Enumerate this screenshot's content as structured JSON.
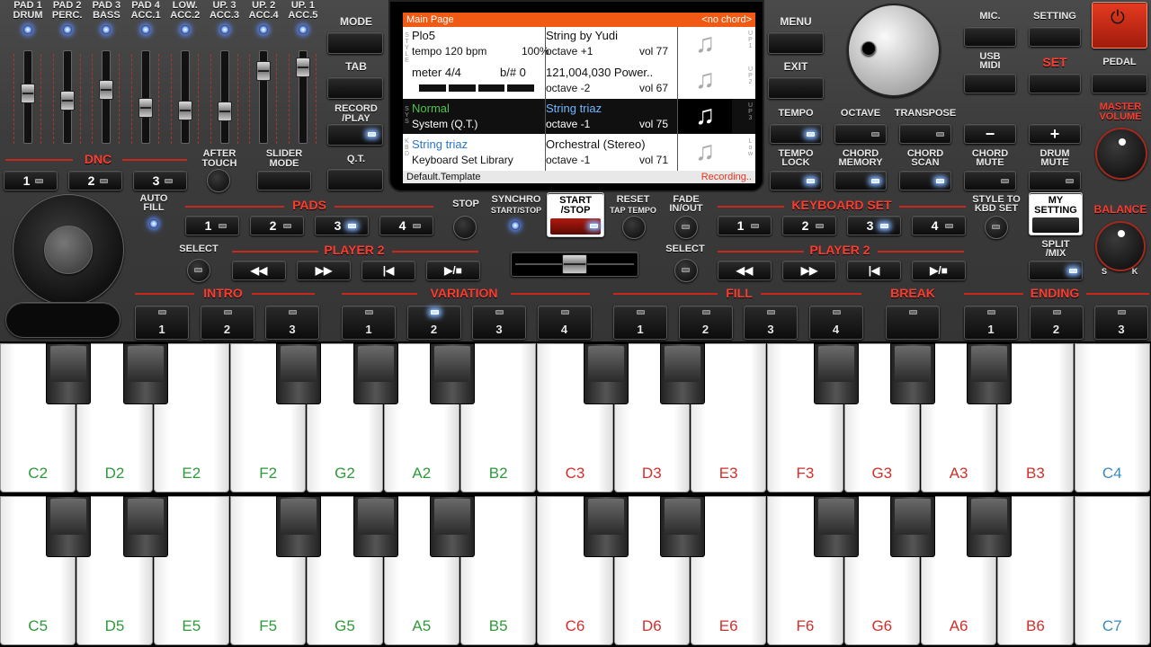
{
  "colors": {
    "accent_red": "#ff3b2e",
    "led_blue": "#7fb2ff",
    "lcd_header": "#f05a14"
  },
  "sliders": [
    {
      "label": "PAD 1\nDRUM",
      "level": 0.55
    },
    {
      "label": "PAD 2\nPERC.",
      "level": 0.45
    },
    {
      "label": "PAD 3\nBASS",
      "level": 0.6
    },
    {
      "label": "PAD 4\nACC.1",
      "level": 0.35
    },
    {
      "label": "LOW.\nACC.2",
      "level": 0.32
    },
    {
      "label": "UP. 3\nACC.3",
      "level": 0.3
    },
    {
      "label": "UP. 2\nACC.4",
      "level": 0.85
    },
    {
      "label": "UP. 1\nACC.5",
      "level": 0.9
    }
  ],
  "left_buttons": {
    "mode": "MODE",
    "tab": "TAB",
    "record": "RECORD\n/PLAY",
    "qt": "Q.T."
  },
  "dnc": {
    "label": "DNC",
    "b1": "1",
    "b2": "2",
    "b3": "3",
    "after_touch": "AFTER\nTOUCH",
    "slider_mode": "SLIDER\nMODE"
  },
  "lcd": {
    "title": "Main Page",
    "chord": "<no chord>",
    "style_name": "Plo5",
    "tempo": "tempo 120 bpm",
    "tempo_pct": "100%",
    "meter": "meter 4/4",
    "bsharp": "b/#  0",
    "up1_name": "String by Yudi",
    "up1_oct": "octave +1",
    "up1_vol": "vol 77",
    "up2_name": "121,004,030 Power..",
    "up2_oct": "octave -2",
    "up2_vol": "vol 67",
    "sys_name": "Normal",
    "sys_sub": "System (Q.T.)",
    "up3_name": "String triaz",
    "up3_oct": "octave -1",
    "up3_vol": "vol 75",
    "kbd_name": "String triaz",
    "kbd_sub": "Keyboard Set Library",
    "low_name": "Orchestral (Stereo)",
    "low_oct": "octave -1",
    "low_vol": "vol 71",
    "footer_left": "Default.Template",
    "footer_right": "Recording..",
    "side_style": "S T Y L E",
    "side_sys": "S Y S",
    "side_kbd": "K B D",
    "side_up1": "U P 1",
    "side_up2": "U P 2",
    "side_up3": "U P 3",
    "side_low": "L o w"
  },
  "right_top": {
    "menu": "MENU",
    "exit": "EXIT",
    "mic": "MIC.",
    "setting": "SETTING",
    "usb_midi": "USB\nMIDI",
    "set": "SET",
    "pedal": "PEDAL",
    "master_volume": "MASTER\nVOLUME",
    "balance": "BALANCE",
    "bal_s": "S",
    "bal_k": "K"
  },
  "function_row": {
    "tempo": "TEMPO",
    "octave": "OCTAVE",
    "transpose": "TRANSPOSE",
    "minus": "−",
    "plus": "+",
    "tempo_lock": "TEMPO\nLOCK",
    "chord_memory": "CHORD\nMEMORY",
    "chord_scan": "CHORD\nSCAN",
    "chord_mute": "CHORD\nMUTE",
    "drum_mute": "DRUM\nMUTE"
  },
  "mid_row": {
    "auto_fill": "AUTO\nFILL",
    "pads": "PADS",
    "stop": "STOP",
    "synchro": "SYNCHRO",
    "synchro_sub": "START/STOP",
    "start_stop": "START\n/STOP",
    "reset": "RESET",
    "tap_tempo": "TAP TEMPO",
    "fade": "FADE\nIN/OUT",
    "keyboard_set": "KEYBOARD SET",
    "style_to_kbd": "STYLE TO\nKBD SET",
    "my_setting": "MY\nSETTING",
    "select": "SELECT",
    "player2": "PLAYER 2",
    "split_mix": "SPLIT\n/MIX",
    "pads_nums": [
      "1",
      "2",
      "3",
      "4"
    ],
    "kbd_nums": [
      "1",
      "2",
      "3",
      "4"
    ]
  },
  "transport": {
    "rew": "◀◀",
    "ff": "▶▶",
    "home": "|◀",
    "play": "▶/■"
  },
  "sections": {
    "intro": "INTRO",
    "variation": "VARIATION",
    "fill": "FILL",
    "break": "BREAK",
    "ending": "ENDING",
    "intro_nums": [
      "1",
      "2",
      "3"
    ],
    "var_nums": [
      "1",
      "2",
      "3",
      "4"
    ],
    "fill_nums": [
      "1",
      "2",
      "3",
      "4"
    ],
    "break_num": "",
    "end_nums": [
      "1",
      "2",
      "3"
    ]
  },
  "keys_top": [
    "C2",
    "D2",
    "E2",
    "F2",
    "G2",
    "A2",
    "B2",
    "C3",
    "D3",
    "E3",
    "F3",
    "G3",
    "A3",
    "B3",
    "C4"
  ],
  "keys_bottom": [
    "C5",
    "D5",
    "E5",
    "F5",
    "G5",
    "A5",
    "B5",
    "C6",
    "D6",
    "E6",
    "F6",
    "G6",
    "A6",
    "B6",
    "C7"
  ],
  "key_colors_top": [
    "green",
    "green",
    "green",
    "green",
    "green",
    "green",
    "green",
    "red",
    "red",
    "red",
    "red",
    "red",
    "red",
    "red",
    "blue"
  ],
  "key_colors_bottom": [
    "green",
    "green",
    "green",
    "green",
    "green",
    "green",
    "green",
    "red",
    "red",
    "red",
    "red",
    "red",
    "red",
    "red",
    "blue"
  ]
}
